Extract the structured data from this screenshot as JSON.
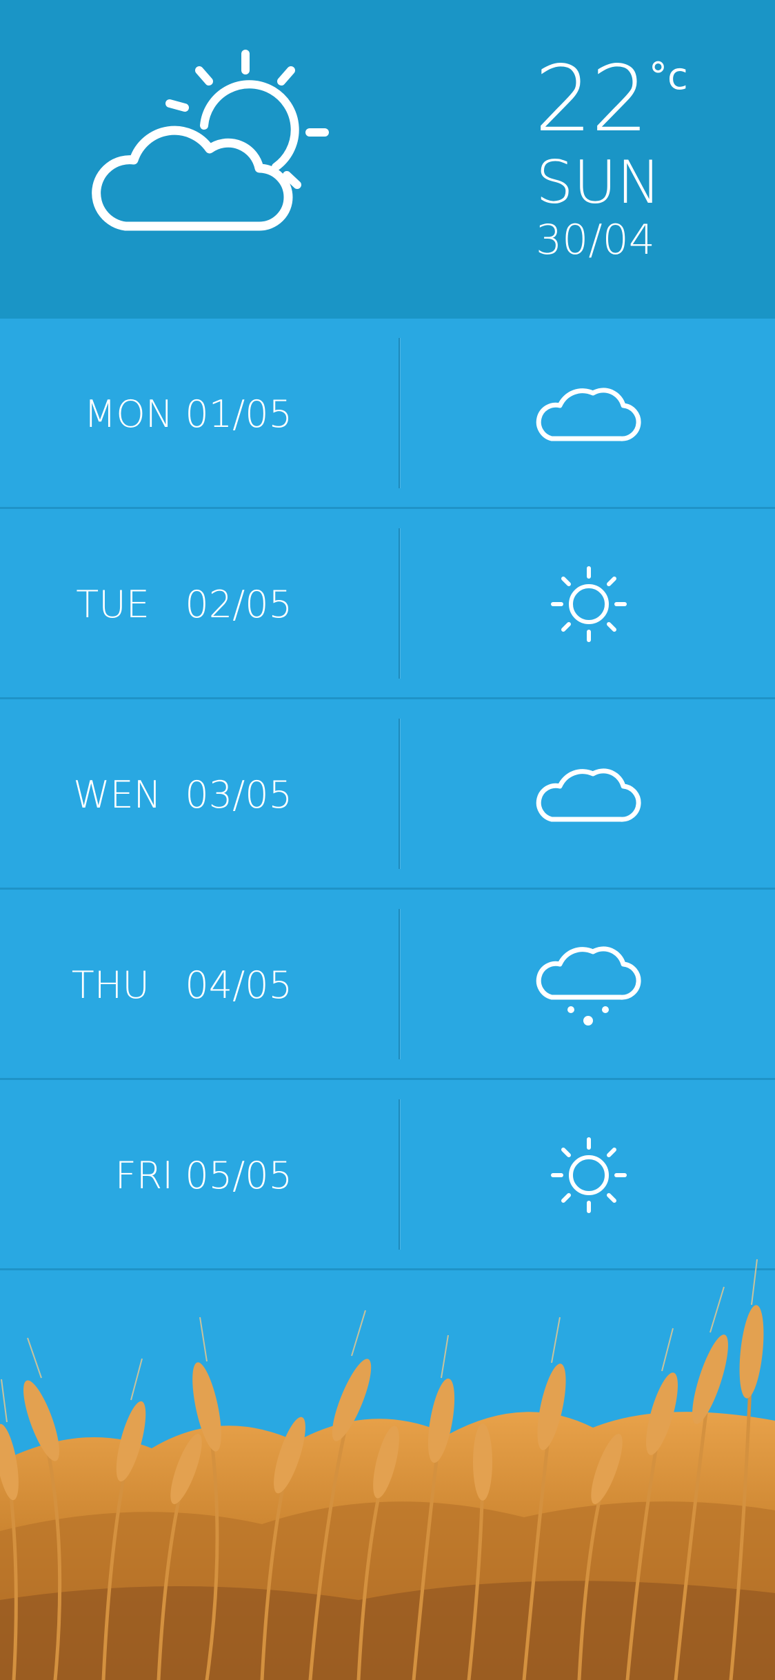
{
  "current": {
    "icon": "partly-cloudy-icon",
    "temperature": "22",
    "unit": "°c",
    "day": "SUN",
    "date": "30/04"
  },
  "forecast": [
    {
      "label": "MON 01/05",
      "icon": "cloud-icon"
    },
    {
      "label": "TUE   02/05",
      "icon": "sun-icon"
    },
    {
      "label": "WEN  03/05",
      "icon": "cloud-icon"
    },
    {
      "label": "THU   04/05",
      "icon": "cloud-drizzle-icon"
    },
    {
      "label": "FRI 05/05",
      "icon": "sun-icon"
    }
  ],
  "colors": {
    "header_bg": "#1a95c6",
    "row_bg": "#29a8e2",
    "text": "#ffffff",
    "wheat": "#d9903a"
  }
}
